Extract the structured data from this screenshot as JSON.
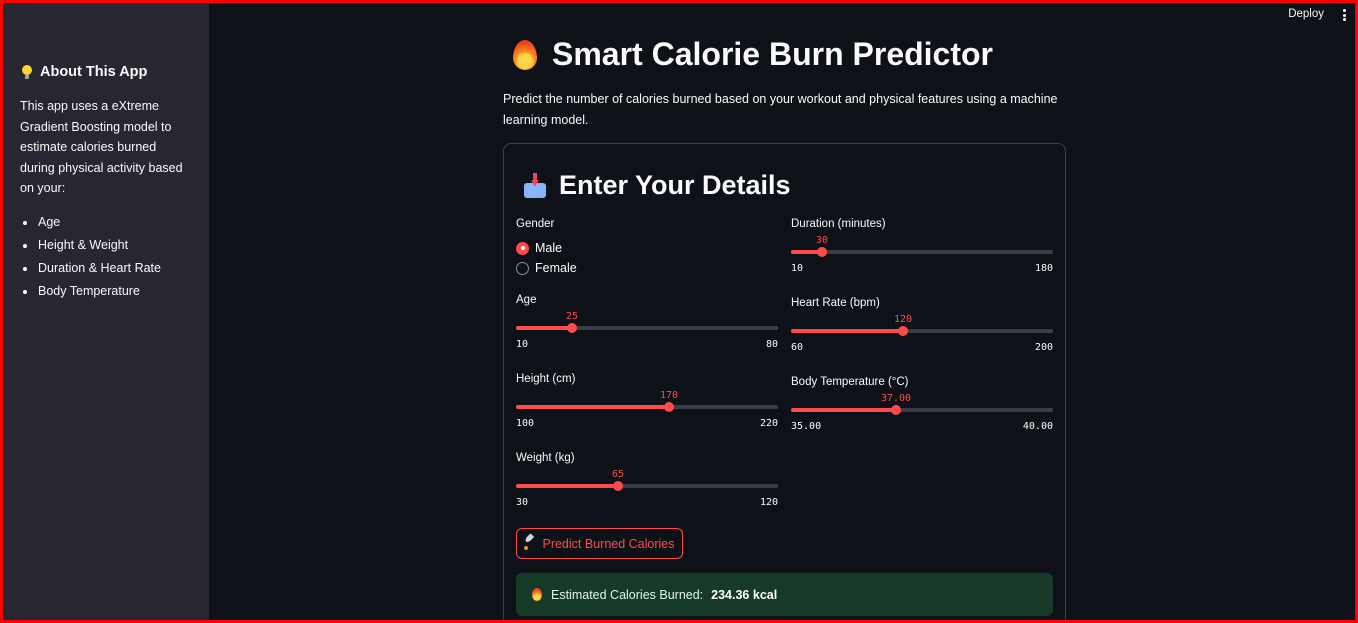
{
  "topbar": {
    "deploy_label": "Deploy"
  },
  "sidebar": {
    "title": "About This App",
    "description": "This app uses a eXtreme Gradient Boosting model to estimate calories burned during physical activity based on your:",
    "items": [
      "Age",
      "Height & Weight",
      "Duration & Heart Rate",
      "Body Temperature"
    ]
  },
  "main": {
    "title": "Smart Calorie Burn Predictor",
    "subtitle": "Predict the number of calories burned based on your workout and physical features using a machine learning model."
  },
  "form": {
    "title": "Enter Your Details",
    "gender": {
      "label": "Gender",
      "options": [
        "Male",
        "Female"
      ],
      "selected": "Male"
    },
    "sliders": {
      "age": {
        "label": "Age",
        "value": 25,
        "display": "25",
        "min": 10,
        "max": 80,
        "min_display": "10",
        "max_display": "80"
      },
      "height": {
        "label": "Height (cm)",
        "value": 170,
        "display": "170",
        "min": 100,
        "max": 220,
        "min_display": "100",
        "max_display": "220"
      },
      "weight": {
        "label": "Weight (kg)",
        "value": 65,
        "display": "65",
        "min": 30,
        "max": 120,
        "min_display": "30",
        "max_display": "120"
      },
      "duration": {
        "label": "Duration (minutes)",
        "value": 30,
        "display": "30",
        "min": 10,
        "max": 180,
        "min_display": "10",
        "max_display": "180"
      },
      "heart_rate": {
        "label": "Heart Rate (bpm)",
        "value": 120,
        "display": "120",
        "min": 60,
        "max": 200,
        "min_display": "60",
        "max_display": "200"
      },
      "body_temp": {
        "label": "Body Temperature (°C)",
        "value": 37.0,
        "display": "37.00",
        "min": 35.0,
        "max": 40.0,
        "min_display": "35.00",
        "max_display": "40.00"
      }
    },
    "predict_button": "Predict Burned Calories",
    "result": {
      "prefix": "Estimated Calories Burned:",
      "value": "234.36 kcal"
    }
  },
  "colors": {
    "accent": "#ff4b4b",
    "success_bg": "#173928",
    "sidebar_bg": "#262730",
    "page_bg": "#0e1117"
  }
}
